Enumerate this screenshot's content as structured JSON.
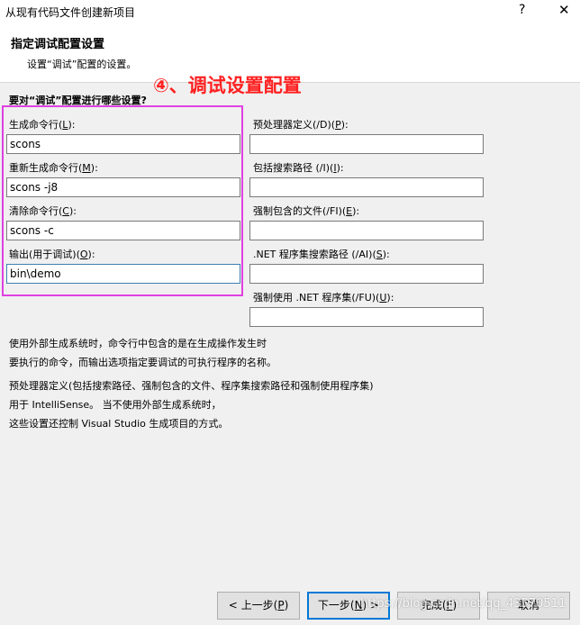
{
  "window": {
    "title": "从现有代码文件创建新项目",
    "help_glyph": "?",
    "close_glyph": "✕"
  },
  "header": {
    "title": "指定调试配置设置",
    "subtitle": "设置“调试”配置的设置。"
  },
  "annotation": {
    "text": "④、调试设置配置",
    "color": "#ff2020",
    "box_color": "#e040e0"
  },
  "question": "要对“调试”配置进行哪些设置?",
  "left_fields": [
    {
      "label": "生成命令行(",
      "key": "L",
      "suffix": "):",
      "value": "scons"
    },
    {
      "label": "重新生成命令行(",
      "key": "M",
      "suffix": "):",
      "value": "scons -j8"
    },
    {
      "label": "清除命令行(",
      "key": "C",
      "suffix": "):",
      "value": "scons -c"
    },
    {
      "label": "输出(用于调试)(",
      "key": "O",
      "suffix": "):",
      "value": "bin\\demo"
    }
  ],
  "right_fields": [
    {
      "label": "预处理器定义(/D)(",
      "key": "P",
      "suffix": "):",
      "value": ""
    },
    {
      "label": "包括搜索路径 (/I)(",
      "key": "I",
      "suffix": "):",
      "value": ""
    },
    {
      "label": "强制包含的文件(/FI)(",
      "key": "E",
      "suffix": "):",
      "value": ""
    },
    {
      "label": ".NET 程序集搜索路径 (/AI)(",
      "key": "S",
      "suffix": "):",
      "value": ""
    },
    {
      "label": "强制使用 .NET 程序集(/FU)(",
      "key": "U",
      "suffix": "):",
      "value": ""
    }
  ],
  "help": {
    "para1": [
      "使用外部生成系统时，命令行中包含的是在生成操作发生时",
      "要执行的命令，而输出选项指定要调试的可执行程序的名称。"
    ],
    "para2": [
      "预处理器定义(包括搜索路径、强制包含的文件、程序集搜索路径和强制使用程序集)",
      "用于 IntelliSense。 当不使用外部生成系统时，",
      "这些设置还控制 Visual Studio 生成项目的方式。"
    ]
  },
  "buttons": {
    "back": {
      "label": "< 上一步(",
      "key": "P",
      "suffix": ")"
    },
    "next": {
      "label": "下一步(",
      "key": "N",
      "suffix": ") >"
    },
    "finish": {
      "label": "完成(",
      "key": "F",
      "suffix": ")"
    },
    "cancel": {
      "label": "取消"
    }
  },
  "watermark": "https://blog.csdn.net/qq_43570511"
}
